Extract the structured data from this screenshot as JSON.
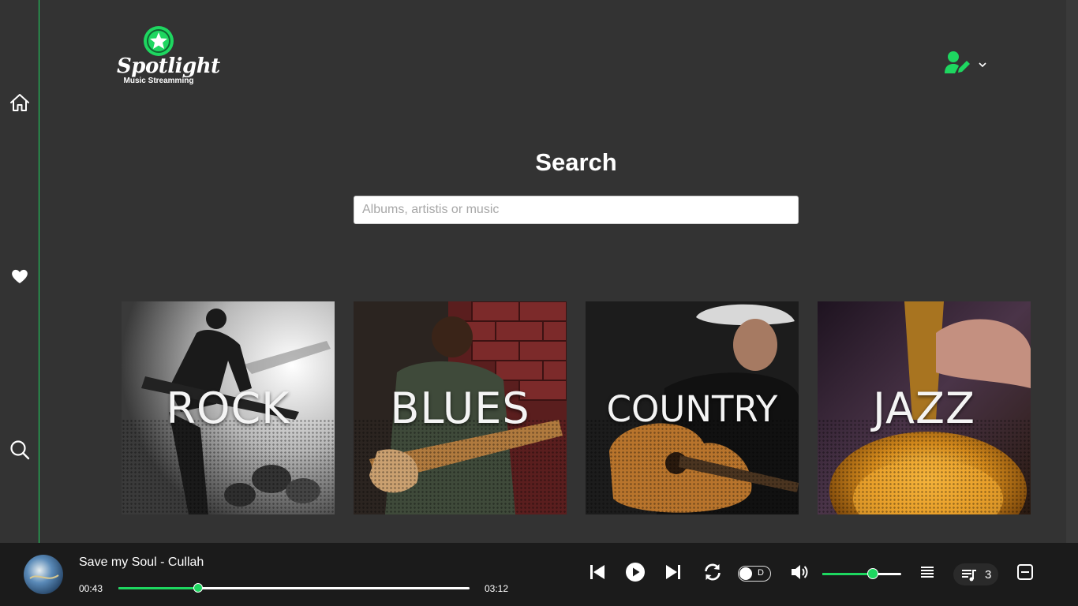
{
  "app": {
    "name": "Spotlight",
    "tagline": "Music Streamming",
    "accent_color": "#1ed760"
  },
  "sidebar": {
    "items": [
      {
        "icon": "home-icon"
      },
      {
        "icon": "heart-icon"
      },
      {
        "icon": "search-icon"
      }
    ]
  },
  "header": {
    "user_icon": "user-edit-icon",
    "dropdown_icon": "chevron-down-icon"
  },
  "search": {
    "title": "Search",
    "placeholder": "Albums, artistis or music",
    "value": ""
  },
  "genres": [
    {
      "label": "ROCK"
    },
    {
      "label": "BLUES"
    },
    {
      "label": "COUNTRY"
    },
    {
      "label": "JAZZ"
    }
  ],
  "player": {
    "track": "Save my Soul - Cullah",
    "elapsed": "00:43",
    "duration": "03:12",
    "progress": 0.227,
    "toggle_label": "D",
    "volume": 0.63,
    "queue_count": "3"
  }
}
